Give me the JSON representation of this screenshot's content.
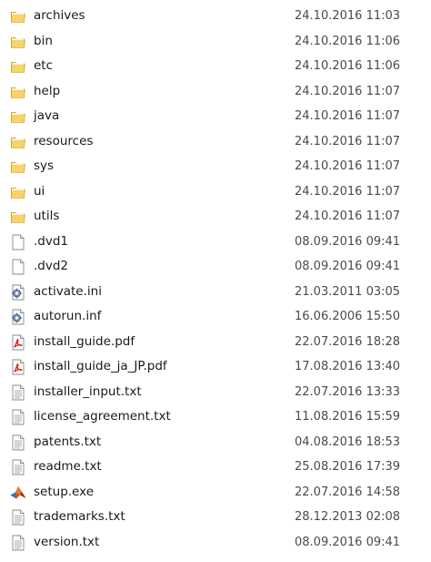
{
  "files": [
    {
      "name": "archives",
      "date": "24.10.2016 11:03",
      "icon": "folder-icon",
      "kind": "folder"
    },
    {
      "name": "bin",
      "date": "24.10.2016 11:06",
      "icon": "folder-icon",
      "kind": "folder"
    },
    {
      "name": "etc",
      "date": "24.10.2016 11:06",
      "icon": "folder-icon",
      "kind": "folder"
    },
    {
      "name": "help",
      "date": "24.10.2016 11:07",
      "icon": "folder-icon",
      "kind": "folder"
    },
    {
      "name": "java",
      "date": "24.10.2016 11:07",
      "icon": "folder-icon",
      "kind": "folder"
    },
    {
      "name": "resources",
      "date": "24.10.2016 11:07",
      "icon": "folder-icon",
      "kind": "folder"
    },
    {
      "name": "sys",
      "date": "24.10.2016 11:07",
      "icon": "folder-icon",
      "kind": "folder"
    },
    {
      "name": "ui",
      "date": "24.10.2016 11:07",
      "icon": "folder-icon",
      "kind": "folder"
    },
    {
      "name": "utils",
      "date": "24.10.2016 11:07",
      "icon": "folder-icon",
      "kind": "folder"
    },
    {
      "name": ".dvd1",
      "date": "08.09.2016 09:41",
      "icon": "blank-file-icon",
      "kind": "blank"
    },
    {
      "name": ".dvd2",
      "date": "08.09.2016 09:41",
      "icon": "blank-file-icon",
      "kind": "blank"
    },
    {
      "name": "activate.ini",
      "date": "21.03.2011 03:05",
      "icon": "settings-file-icon",
      "kind": "settings"
    },
    {
      "name": "autorun.inf",
      "date": "16.06.2006 15:50",
      "icon": "settings-file-icon",
      "kind": "settings"
    },
    {
      "name": "install_guide.pdf",
      "date": "22.07.2016 18:28",
      "icon": "pdf-file-icon",
      "kind": "pdf"
    },
    {
      "name": "install_guide_ja_JP.pdf",
      "date": "17.08.2016 13:40",
      "icon": "pdf-file-icon",
      "kind": "pdf"
    },
    {
      "name": "installer_input.txt",
      "date": "22.07.2016 13:33",
      "icon": "text-file-icon",
      "kind": "text"
    },
    {
      "name": "license_agreement.txt",
      "date": "11.08.2016 15:59",
      "icon": "text-file-icon",
      "kind": "text"
    },
    {
      "name": "patents.txt",
      "date": "04.08.2016 18:53",
      "icon": "text-file-icon",
      "kind": "text"
    },
    {
      "name": "readme.txt",
      "date": "25.08.2016 17:39",
      "icon": "text-file-icon",
      "kind": "text"
    },
    {
      "name": "setup.exe",
      "date": "22.07.2016 14:58",
      "icon": "matlab-app-icon",
      "kind": "exe"
    },
    {
      "name": "trademarks.txt",
      "date": "28.12.2013 02:08",
      "icon": "text-file-icon",
      "kind": "text"
    },
    {
      "name": "version.txt",
      "date": "08.09.2016 09:41",
      "icon": "text-file-icon",
      "kind": "text"
    }
  ]
}
